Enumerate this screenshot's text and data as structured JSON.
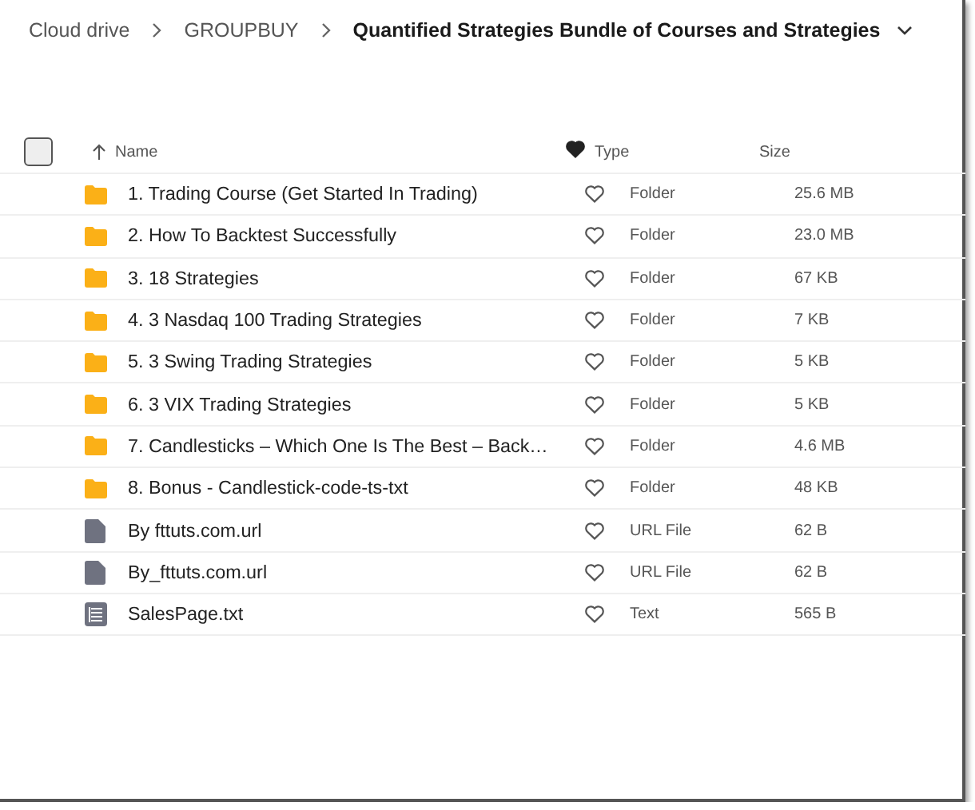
{
  "breadcrumb": [
    {
      "label": "Cloud drive",
      "current": false
    },
    {
      "label": "GROUPBUY",
      "current": false
    },
    {
      "label": "Quantified Strategies Bundle of Courses and Strategies",
      "current": true
    }
  ],
  "table": {
    "select_all": {
      "checked": false
    },
    "columns": [
      "Name",
      "Type",
      "Size"
    ],
    "rows": [
      {
        "kind": "folder",
        "name": "1. Trading Course (Get Started In Trading)",
        "type": "Folder",
        "size": "25.6 MB"
      },
      {
        "kind": "folder",
        "name": "2. How To Backtest Successfully",
        "type": "Folder",
        "size": "23.0 MB"
      },
      {
        "kind": "folder",
        "name": "3. 18 Strategies",
        "type": "Folder",
        "size": "67 KB"
      },
      {
        "kind": "folder",
        "name": "4. 3 Nasdaq 100 Trading Strategies",
        "type": "Folder",
        "size": "7 KB"
      },
      {
        "kind": "folder",
        "name": "5. 3 Swing Trading Strategies",
        "type": "Folder",
        "size": "5 KB"
      },
      {
        "kind": "folder",
        "name": "6. 3 VIX Trading Strategies",
        "type": "Folder",
        "size": "5 KB"
      },
      {
        "kind": "folder",
        "name": "7. Candlesticks – Which One Is The Best – Back…",
        "type": "Folder",
        "size": "4.6 MB"
      },
      {
        "kind": "folder",
        "name": "8. Bonus - Candlestick-code-ts-txt",
        "type": "Folder",
        "size": "48 KB"
      },
      {
        "kind": "file",
        "name": "By fttuts.com.url",
        "type": "URL File",
        "size": "62 B"
      },
      {
        "kind": "file",
        "name": "By_fttuts.com.url",
        "type": "URL File",
        "size": "62 B"
      },
      {
        "kind": "text",
        "name": "SalesPage.txt",
        "type": "Text",
        "size": "565 B"
      }
    ]
  }
}
